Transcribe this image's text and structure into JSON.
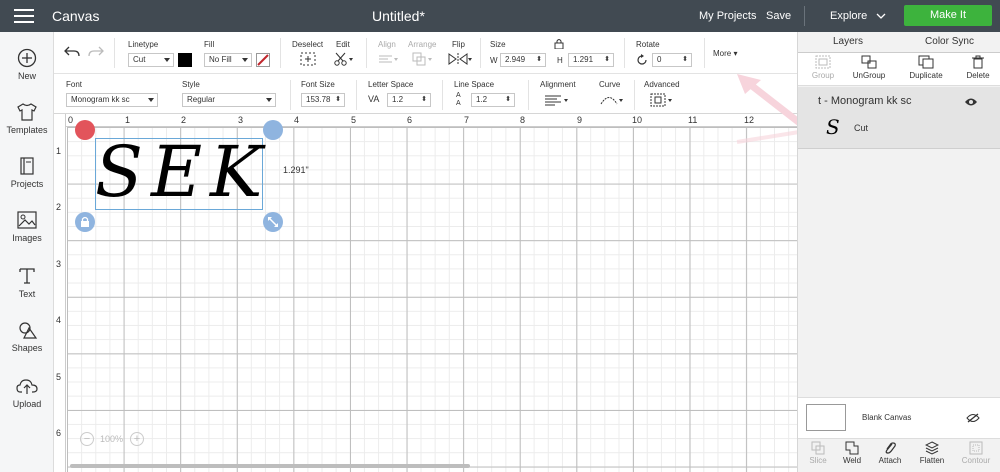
{
  "topbar": {
    "app_title": "Canvas",
    "doc_title": "Untitled*",
    "my_projects": "My Projects",
    "save": "Save",
    "explore": "Explore",
    "make_it": "Make It"
  },
  "sidebar": {
    "items": [
      {
        "label": "New",
        "icon": "plus-circle-icon"
      },
      {
        "label": "Templates",
        "icon": "tshirt-icon"
      },
      {
        "label": "Projects",
        "icon": "book-icon"
      },
      {
        "label": "Images",
        "icon": "image-icon"
      },
      {
        "label": "Text",
        "icon": "text-t-icon"
      },
      {
        "label": "Shapes",
        "icon": "shapes-icon"
      },
      {
        "label": "Upload",
        "icon": "cloud-upload-icon"
      }
    ]
  },
  "toolbar1": {
    "linetype_label": "Linetype",
    "linetype_value": "Cut",
    "fill_label": "Fill",
    "fill_value": "No Fill",
    "deselect": "Deselect",
    "edit": "Edit",
    "align": "Align",
    "arrange": "Arrange",
    "flip": "Flip",
    "size_label": "Size",
    "w_label": "W",
    "w_value": "2.949",
    "h_label": "H",
    "h_value": "1.291",
    "rotate_label": "Rotate",
    "rotate_value": "0",
    "more": "More"
  },
  "toolbar2": {
    "font_label": "Font",
    "font_value": "Monogram kk sc",
    "style_label": "Style",
    "style_value": "Regular",
    "font_size_label": "Font Size",
    "font_size_value": "153.78",
    "letter_space_label": "Letter Space",
    "letter_space_value": "1.2",
    "line_space_label": "Line Space",
    "line_space_value": "1.2",
    "alignment_label": "Alignment",
    "curve_label": "Curve",
    "advanced_label": "Advanced"
  },
  "canvas": {
    "ruler_top": [
      "0",
      "1",
      "2",
      "3",
      "4",
      "5",
      "6",
      "7",
      "8",
      "9",
      "10",
      "11",
      "12"
    ],
    "ruler_left": [
      "1",
      "2",
      "3",
      "4",
      "5",
      "6"
    ],
    "monogram_text": "SEK",
    "height_label": "1.291\"",
    "zoom": "100%",
    "zoom_minus": "−",
    "zoom_plus": "+"
  },
  "rpanel": {
    "tab_layers": "Layers",
    "tab_color_sync": "Color Sync",
    "tools": [
      {
        "label": "Group",
        "enabled": false
      },
      {
        "label": "UnGroup",
        "enabled": true
      },
      {
        "label": "Duplicate",
        "enabled": true
      },
      {
        "label": "Delete",
        "enabled": true
      }
    ],
    "layer_name": "t - Monogram kk sc",
    "layer_sub": "Cut",
    "blank_canvas": "Blank Canvas",
    "bottom_tools": [
      {
        "label": "Slice",
        "enabled": false
      },
      {
        "label": "Weld",
        "enabled": true
      },
      {
        "label": "Attach",
        "enabled": true
      },
      {
        "label": "Flatten",
        "enabled": true
      },
      {
        "label": "Contour",
        "enabled": false
      }
    ]
  },
  "colors": {
    "topbar": "#414a52",
    "make_it": "#3db33d",
    "selection": "#6aa8d8",
    "handle_red": "#e2545b",
    "handle_blue": "#8fb4df"
  }
}
